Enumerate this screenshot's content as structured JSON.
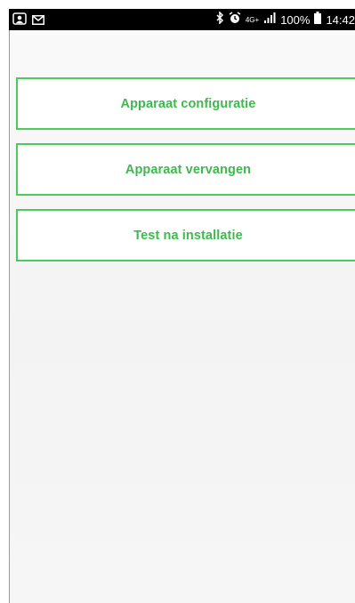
{
  "status_bar": {
    "icons_left": [
      "contact-card-icon",
      "mail-icon"
    ],
    "icons_right": [
      "bluetooth-icon",
      "alarm-icon",
      "network-4g-icon",
      "signal-icon",
      "battery-icon"
    ],
    "network_label": "4G+",
    "battery": "100%",
    "time": "14:42"
  },
  "menu": {
    "items": [
      {
        "label": "Apparaat configuratie"
      },
      {
        "label": "Apparaat vervangen"
      },
      {
        "label": "Test na installatie"
      }
    ]
  },
  "colors": {
    "accent": "#3fb84f",
    "border": "#4ccb5c",
    "status_bar": "#000000"
  }
}
